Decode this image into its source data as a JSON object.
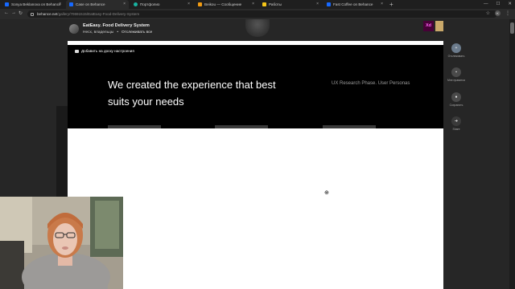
{
  "browser": {
    "tabs": [
      {
        "label": "Sonya Beklanova on Behance",
        "color": "#1769ff"
      },
      {
        "label": "Case on Behance",
        "color": "#1769ff"
      },
      {
        "label": "Портфолио",
        "color": "#19b3a1"
      },
      {
        "label": "Beikou — Сообщение",
        "color": "#f39c12"
      },
      {
        "label": "Работы",
        "color": "#f5c518"
      },
      {
        "label": "Fast Coffee on Behance",
        "color": "#1769ff"
      }
    ],
    "active_tab": 1,
    "new_tab": "+",
    "address": {
      "host": "behance.net",
      "path": "/gallery/70691515/EatEasy-Food-Delivery-System"
    },
    "profile_initial": "K"
  },
  "project": {
    "title": "EatEasy. Food Delivery System",
    "owner": "Несх, владельцы",
    "separator": "•",
    "follow_all": "Отслеживать все",
    "xd_label": "Xd",
    "moodboard_label": "Добавить на доску настроения",
    "hero_title": "We created the experience that best suits your needs",
    "hero_subtitle": "UX Research Phase. User Personas"
  },
  "rail": [
    {
      "label": "Отслеживать",
      "icon": "follow-avatar-icon"
    },
    {
      "label": "Мне нравится",
      "icon": "like-icon"
    },
    {
      "label": "Сохранить",
      "icon": "save-icon"
    },
    {
      "label": "Share",
      "icon": "share-icon"
    }
  ],
  "colors": {
    "viewer_bg": "#262626",
    "hero_bg": "#000000",
    "xd_bg": "#470137",
    "xd_fg": "#ff61f6"
  }
}
